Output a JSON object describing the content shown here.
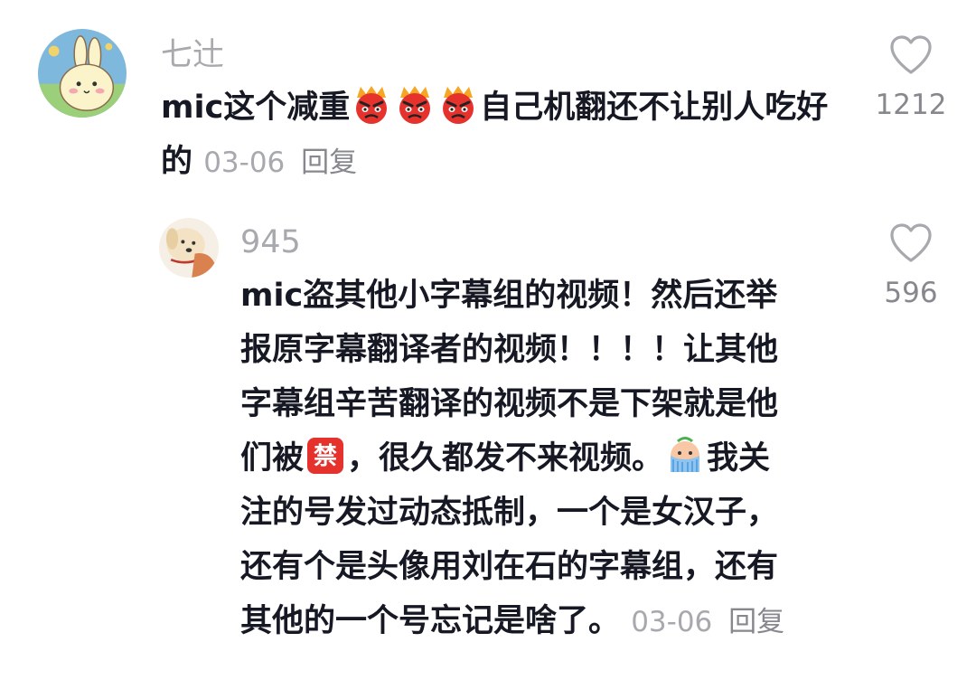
{
  "comments": [
    {
      "username": "七辻",
      "avatar_icon": "bunny-avatar",
      "text_parts": [
        "mic这个减重",
        "自己机翻还不让别人吃好的"
      ],
      "emojis": [
        "angry-face-emoji",
        "angry-face-emoji",
        "angry-face-emoji"
      ],
      "date": "03-06",
      "reply_label": "回复",
      "like_icon": "heart-icon",
      "like_count": "1212"
    },
    {
      "username": "945",
      "avatar_icon": "dog-avatar",
      "text_lines": [
        "mic盗其他小字幕组的视频！然后还举",
        "报原字幕翻译者的视频！！！！让其他",
        "字幕组辛苦翻译的视频不是下架就是他"
      ],
      "text_line4_a": "们被",
      "text_line4_b": "，很久都发不来视频。",
      "text_line4_c": "我关",
      "text_lines_rest": [
        "注的号发过动态抵制，一个是女汉子，",
        "还有个是头像用刘在石的字幕组，还有",
        "其他的一个号忘记是啥了。"
      ],
      "emojis": [
        "forbidden-badge-emoji",
        "crying-face-emoji"
      ],
      "forbidden_badge_text": "禁",
      "date": "03-06",
      "reply_label": "回复",
      "like_icon": "heart-icon",
      "like_count": "596"
    }
  ],
  "colors": {
    "text": "#161823",
    "meta": "#a7a9ae",
    "accent_red": "#e5322d"
  }
}
